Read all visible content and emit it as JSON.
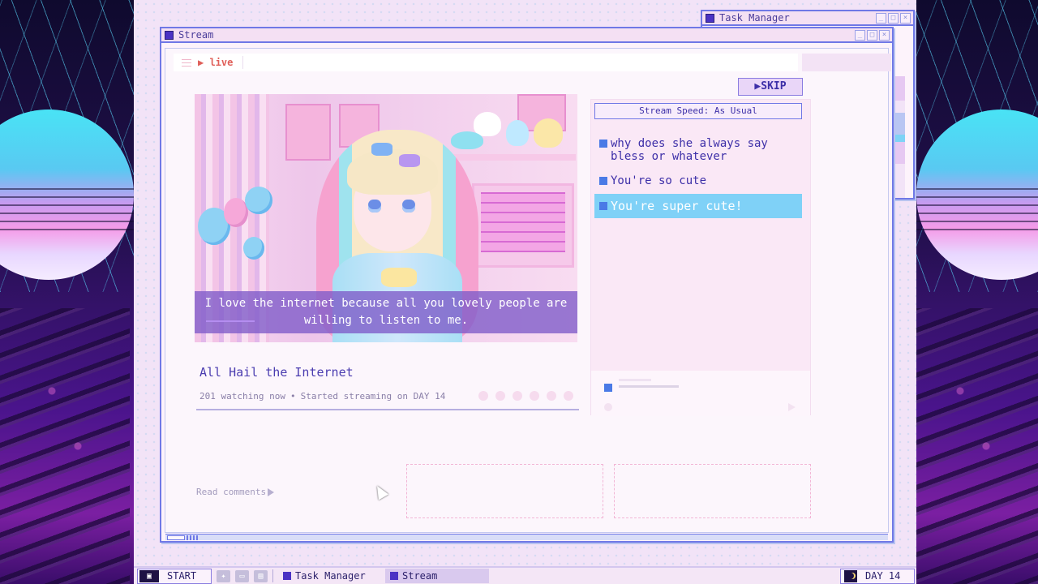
{
  "windows": {
    "task_manager": {
      "title": "Task Manager"
    },
    "stream": {
      "title": "Stream"
    }
  },
  "stream": {
    "live_label": "live",
    "skip_label": "SKIP",
    "subtitle": "I love the internet because all you lovely people are willing to listen to me.",
    "title": "All Hail the Internet",
    "watching": "201 watching now",
    "separator": "•",
    "started": "Started streaming on DAY 14",
    "read_comments": "Read comments"
  },
  "chat": {
    "speed_label": "Stream Speed: As Usual",
    "comments": [
      {
        "text": "why does she always say bless or whatever",
        "selected": false
      },
      {
        "text": "You're so cute",
        "selected": false
      },
      {
        "text": "You're super cute!",
        "selected": true
      }
    ]
  },
  "taskbar": {
    "start_label": "START",
    "tasks": [
      {
        "label": "Task Manager",
        "active": false
      },
      {
        "label": "Stream",
        "active": true
      }
    ],
    "day_label": "DAY 14"
  },
  "icons": [
    "menu-icon",
    "play-icon",
    "twitter-icon",
    "chat-icon",
    "monitor-icon",
    "moon-icon",
    "cursor-icon"
  ],
  "colors": {
    "accent": "#4b33c4",
    "selected_comment": "#7fd1f7",
    "live_red": "#e0605a",
    "window_border": "#6f78e6"
  }
}
